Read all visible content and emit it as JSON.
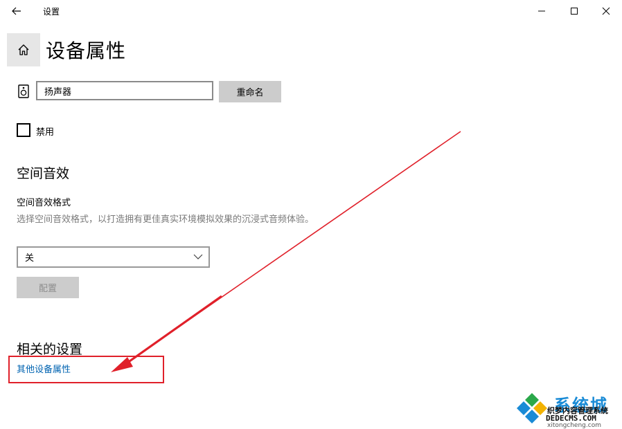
{
  "window": {
    "title": "设置",
    "back_icon": "arrow-left-icon",
    "controls": [
      "minimize-icon",
      "maximize-icon",
      "close-icon"
    ]
  },
  "header": {
    "home_icon": "home-icon",
    "page_title": "设备属性"
  },
  "device": {
    "icon": "speaker-icon",
    "name_value": "扬声器",
    "rename_label": "重命名",
    "disable_label": "禁用",
    "disable_checked": false
  },
  "spatial": {
    "heading": "空间音效",
    "format_label": "空间音效格式",
    "format_description": "选择空间音效格式，以打造拥有更佳真实环境模拟效果的沉浸式音频体验。",
    "format_selected": "关",
    "configure_label": "配置",
    "configure_enabled": false
  },
  "related": {
    "heading": "相关的设置",
    "other_properties_link": "其他设备属性",
    "link_color": "#0063b1"
  },
  "annotation": {
    "color": "#e0202a"
  },
  "watermark": {
    "brand": "系统城",
    "cn_text": "织梦内容管理系统",
    "url": "DEDECMS.COM",
    "sub": "xitongcheng.com"
  }
}
